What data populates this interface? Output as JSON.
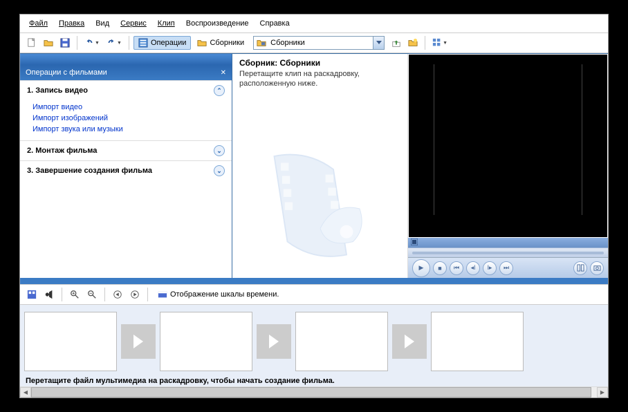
{
  "menu": {
    "file": "Файл",
    "edit": "Правка",
    "view": "Вид",
    "tools": "Сервис",
    "clip": "Клип",
    "play": "Воспроизведение",
    "help": "Справка"
  },
  "toolbar": {
    "operations": "Операции",
    "collections": "Сборники",
    "location": "Сборники"
  },
  "tasks": {
    "title": "Операции с фильмами",
    "g1": {
      "title": "1. Запись видео",
      "links": {
        "a": "Импорт видео",
        "b": "Импорт изображений",
        "c": "Импорт звука или музыки"
      }
    },
    "g2": {
      "title": "2. Монтаж фильма"
    },
    "g3": {
      "title": "3. Завершение создания фильма"
    }
  },
  "collections": {
    "title": "Сборник: Сборники",
    "sub": "Перетащите клип на раскадровку, расположенную ниже."
  },
  "timeline": {
    "toggle": "Отображение шкалы времени.",
    "hint": "Перетащите файл мультимедиа на раскадровку, чтобы начать создание фильма."
  }
}
